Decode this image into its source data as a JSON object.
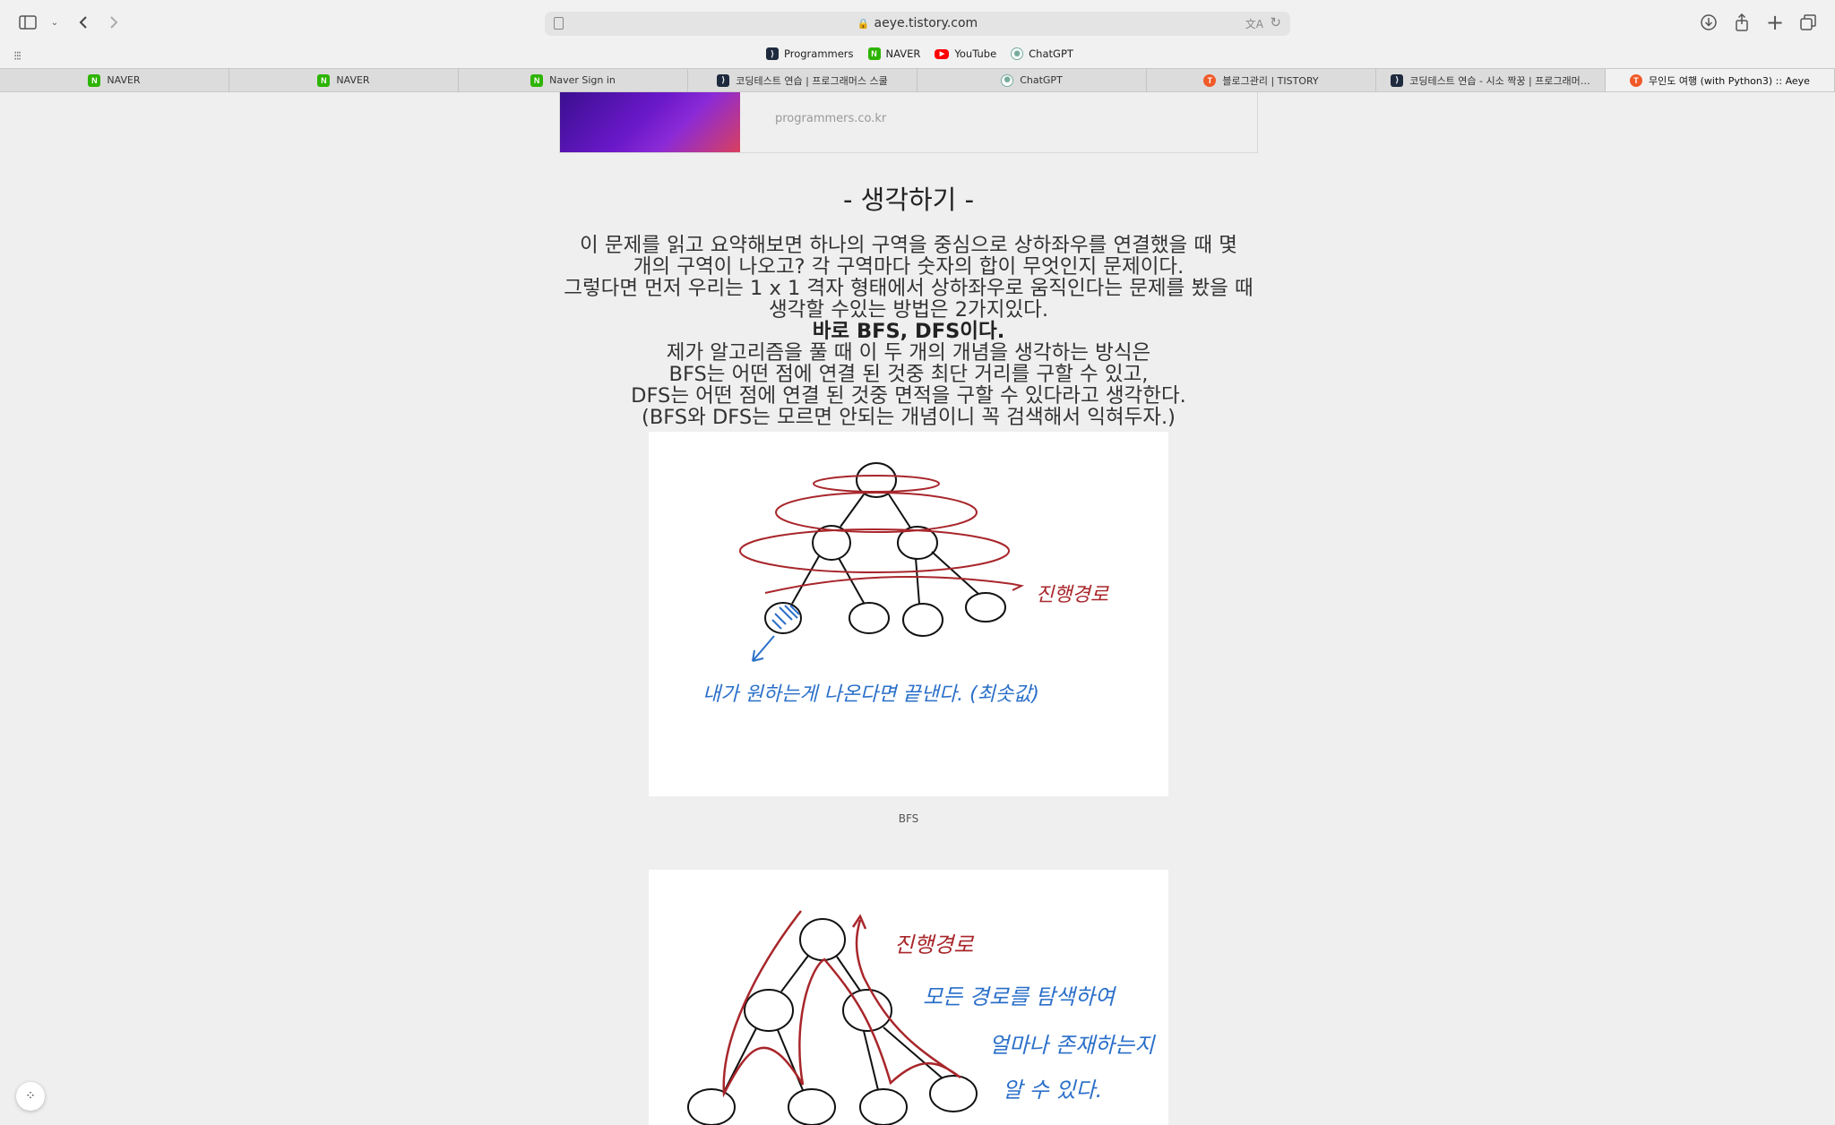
{
  "browser": {
    "url": "aeye.tistory.com",
    "favorites": [
      {
        "label": "Programmers",
        "icon": "programmers-icon"
      },
      {
        "label": "NAVER",
        "icon": "naver-icon"
      },
      {
        "label": "YouTube",
        "icon": "youtube-icon"
      },
      {
        "label": "ChatGPT",
        "icon": "chatgpt-icon"
      }
    ],
    "tabs": [
      {
        "label": "NAVER",
        "icon": "naver-icon"
      },
      {
        "label": "NAVER",
        "icon": "naver-icon"
      },
      {
        "label": "Naver Sign in",
        "icon": "naver-icon"
      },
      {
        "label": "코딩테스트 연습 | 프로그래머스 스쿨",
        "icon": "programmers-icon"
      },
      {
        "label": "ChatGPT",
        "icon": "chatgpt-icon"
      },
      {
        "label": "블로그관리 | TISTORY",
        "icon": "tistory-icon"
      },
      {
        "label": "코딩테스트 연습 - 시소 짝꿍 | 프로그래머…",
        "icon": "programmers-icon"
      },
      {
        "label": "무인도 여행 (with Python3) :: Aeye",
        "icon": "tistory-icon",
        "active": true
      }
    ]
  },
  "article": {
    "link_card_url": "programmers.co.kr",
    "heading": "- 생각하기 -",
    "lines": [
      "이 문제를 읽고 요약해보면 하나의 구역을 중심으로 상하좌우를 연결했을 때 몇",
      "개의 구역이 나오고? 각 구역마다 숫자의 합이 무엇인지 문제이다.",
      "그렇다면 먼저 우리는 1 x 1 격자 형태에서 상하좌우로 움직인다는 문제를 봤을 때",
      "생각할 수있는 방법은 2가지있다.",
      "바로 BFS, DFS이다.",
      "제가 알고리즘을 풀 때 이 두 개의 개념을 생각하는 방식은",
      "BFS는 어떤 점에 연결 된 것중 최단 거리를 구할 수 있고,",
      "DFS는 어떤 점에 연결 된 것중 면적을 구할 수 있다라고 생각한다.",
      "(BFS와 DFS는 모르면 안되는 개념이니 꼭 검색해서 익혀두자.)"
    ],
    "figure1": {
      "path_label": "진행경로",
      "note": "내가 원하는게 나온다면 끝낸다. (최솟값)",
      "caption": "BFS"
    },
    "figure2": {
      "path_label": "진행경로",
      "note_lines": [
        "모든 경로를 탐색하여",
        "얼마나 존재하는지",
        "알 수 있다."
      ]
    }
  },
  "colors": {
    "red_ink": "#a8262b",
    "blue_ink": "#2a6fc9",
    "black_ink": "#111111"
  }
}
